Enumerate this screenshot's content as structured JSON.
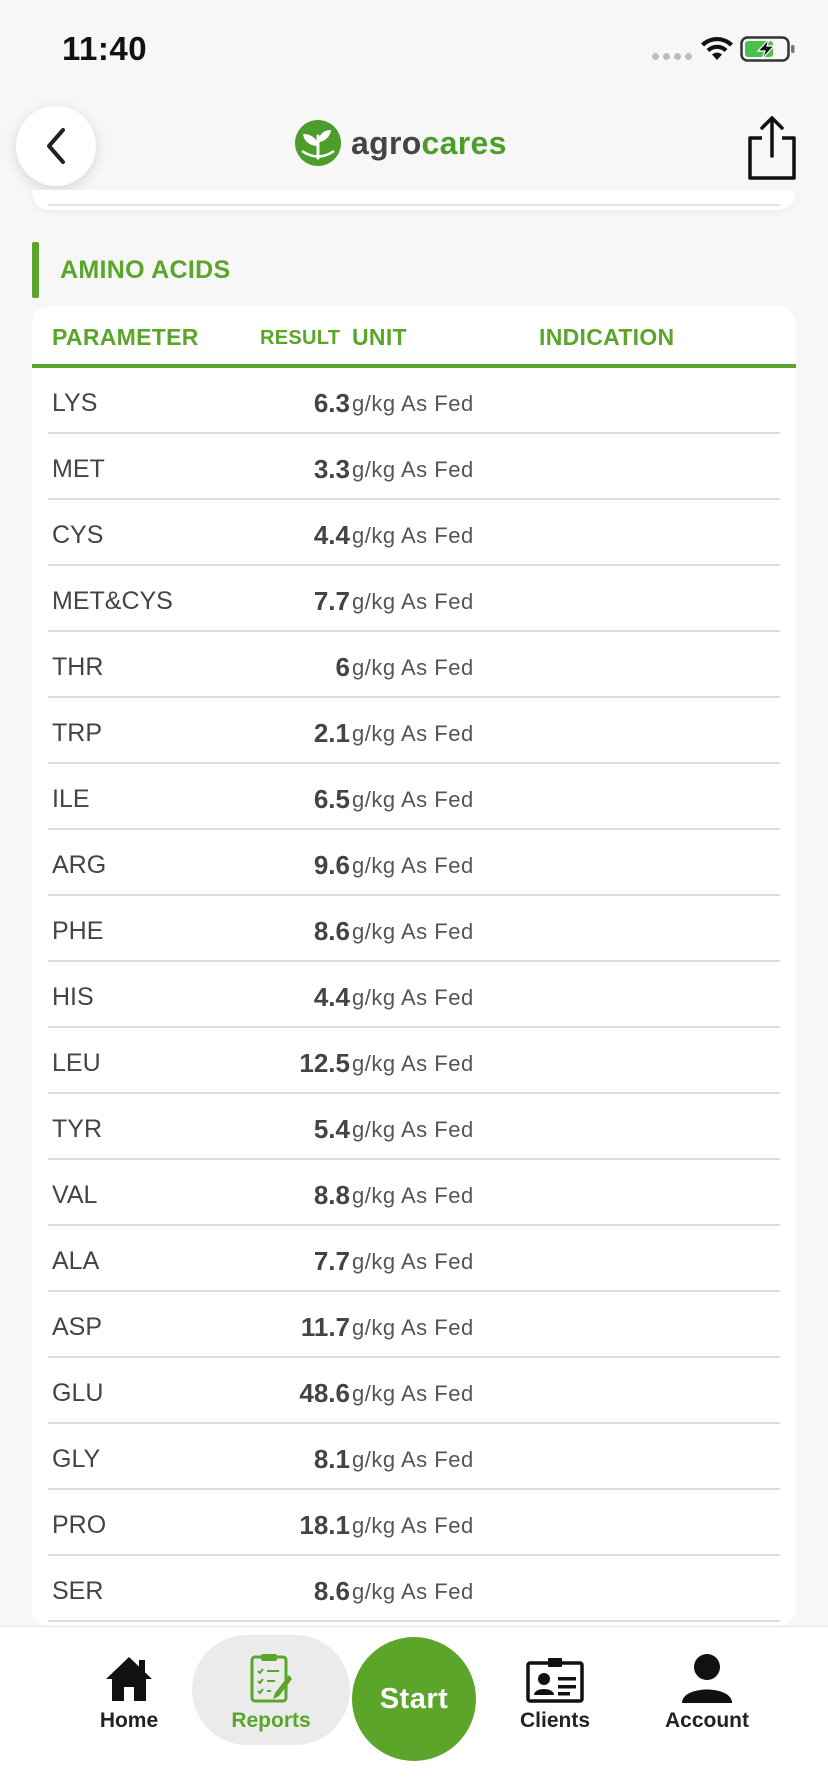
{
  "status_bar": {
    "time": "11:40",
    "icons": [
      "cellular-dots-icon",
      "wifi-icon",
      "battery-charging-icon"
    ]
  },
  "header": {
    "logo_part1": "agro",
    "logo_part2": "cares",
    "icons": [
      "back-chevron-icon",
      "leaf-logo-icon",
      "share-icon"
    ]
  },
  "section": {
    "title": "AMINO ACIDS"
  },
  "table": {
    "headers": {
      "parameter": "PARAMETER",
      "result": "RESULT",
      "unit": "UNIT",
      "indication": "INDICATION"
    },
    "rows": [
      {
        "parameter": "LYS",
        "result": "6.3",
        "unit": "g/kg As Fed"
      },
      {
        "parameter": "MET",
        "result": "3.3",
        "unit": "g/kg As Fed"
      },
      {
        "parameter": "CYS",
        "result": "4.4",
        "unit": "g/kg As Fed"
      },
      {
        "parameter": "MET&CYS",
        "result": "7.7",
        "unit": "g/kg As Fed"
      },
      {
        "parameter": "THR",
        "result": "6",
        "unit": "g/kg As Fed"
      },
      {
        "parameter": "TRP",
        "result": "2.1",
        "unit": "g/kg As Fed"
      },
      {
        "parameter": "ILE",
        "result": "6.5",
        "unit": "g/kg As Fed"
      },
      {
        "parameter": "ARG",
        "result": "9.6",
        "unit": "g/kg As Fed"
      },
      {
        "parameter": "PHE",
        "result": "8.6",
        "unit": "g/kg As Fed"
      },
      {
        "parameter": "HIS",
        "result": "4.4",
        "unit": "g/kg As Fed"
      },
      {
        "parameter": "LEU",
        "result": "12.5",
        "unit": "g/kg As Fed"
      },
      {
        "parameter": "TYR",
        "result": "5.4",
        "unit": "g/kg As Fed"
      },
      {
        "parameter": "VAL",
        "result": "8.8",
        "unit": "g/kg As Fed"
      },
      {
        "parameter": "ALA",
        "result": "7.7",
        "unit": "g/kg As Fed"
      },
      {
        "parameter": "ASP",
        "result": "11.7",
        "unit": "g/kg As Fed"
      },
      {
        "parameter": "GLU",
        "result": "48.6",
        "unit": "g/kg As Fed"
      },
      {
        "parameter": "GLY",
        "result": "8.1",
        "unit": "g/kg As Fed"
      },
      {
        "parameter": "PRO",
        "result": "18.1",
        "unit": "g/kg As Fed"
      },
      {
        "parameter": "SER",
        "result": "8.6",
        "unit": "g/kg As Fed"
      }
    ]
  },
  "tab_bar": {
    "home": "Home",
    "reports": "Reports",
    "start": "Start",
    "clients": "Clients",
    "account": "Account",
    "active": "reports"
  },
  "colors": {
    "accent": "#5aa52a",
    "text": "#444444",
    "background": "#f7f7f7"
  }
}
